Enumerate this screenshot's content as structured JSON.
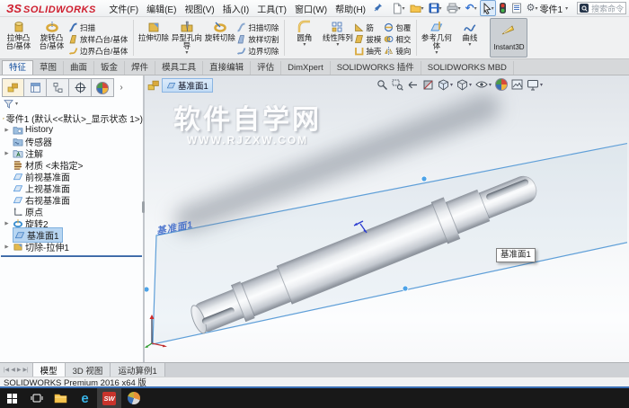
{
  "menubar": {
    "logo_glyph": "ЗS",
    "logo_text": "SOLIDWORKS",
    "menus": [
      "文件(F)",
      "编辑(E)",
      "视图(V)",
      "插入(I)",
      "工具(T)",
      "窗口(W)",
      "帮助(H)"
    ],
    "doc_switcher": "零件1",
    "search_placeholder": "搜索命令"
  },
  "glyphs": {
    "dropdown": "▾",
    "expander": "▶",
    "panel_chevron": "›",
    "undo": "↶",
    "gear": "⚙",
    "edge_e": "e",
    "sw_logo": "SW",
    "nav_first": "|◀",
    "nav_prev": "◀",
    "nav_next": "▶",
    "nav_last": "▶|"
  },
  "ribbon": {
    "big1": [
      {
        "label": "拉伸凸台/基体"
      },
      {
        "label": "旋转凸台/基体"
      }
    ],
    "small1": [
      "扫描",
      "放样凸台/基体",
      "边界凸台/基体"
    ],
    "big2": [
      {
        "label": "拉伸切除"
      },
      {
        "label": "异型孔向导"
      },
      {
        "label": "旋转切除"
      }
    ],
    "small2": [
      "扫描切除",
      "放样切割",
      "边界切除"
    ],
    "big3": [
      {
        "label": "圆角"
      },
      {
        "label": "线性阵列"
      }
    ],
    "small3a": [
      "筋",
      "拔模",
      "抽壳"
    ],
    "small3b": [
      "包覆",
      "相交",
      "镜向"
    ],
    "big4": [
      {
        "label": "参考几何体"
      },
      {
        "label": "曲线"
      }
    ],
    "instant3d_label": "Instant3D"
  },
  "command_tabs": {
    "tabs": [
      "特征",
      "草图",
      "曲面",
      "钣金",
      "焊件",
      "模具工具",
      "直接编辑",
      "评估",
      "DimXpert",
      "SOLIDWORKS 插件",
      "SOLIDWORKS MBD"
    ],
    "active": "特征"
  },
  "feature_tree": {
    "root": "零件1 (默认<<默认>_显示状态 1>)",
    "items": [
      {
        "label": "History"
      },
      {
        "label": "传感器"
      },
      {
        "label": "注解"
      },
      {
        "label": "材质 <未指定>"
      },
      {
        "label": "前视基准面"
      },
      {
        "label": "上视基准面"
      },
      {
        "label": "右视基准面"
      },
      {
        "label": "原点"
      },
      {
        "label": "旋转2"
      },
      {
        "label": "基准面1"
      },
      {
        "label": "切除-拉伸1"
      }
    ]
  },
  "viewport": {
    "breadcrumb": "基准面1",
    "plane_label": "基准面1",
    "tooltip": "基准面1",
    "watermark_line1": "软件自学网",
    "watermark_line2": "WWW.RJZXW.COM"
  },
  "doc_tabs": {
    "tabs": [
      "模型",
      "3D 视图",
      "运动算例1"
    ],
    "active": "模型"
  },
  "status_bar": {
    "text": "SOLIDWORKS Premium 2016 x64 版"
  },
  "taskbar": {
    "icons": [
      "start",
      "task-view",
      "file-explorer",
      "edge",
      "solidworks",
      "media-player"
    ]
  },
  "colors": {
    "logo_red": "#cf1f2f",
    "accent_blue": "#3a6fb5",
    "selection_fill": "#b8d6f2",
    "plane_edge": "#5f9fd8",
    "taskbar_bg": "#181818"
  }
}
